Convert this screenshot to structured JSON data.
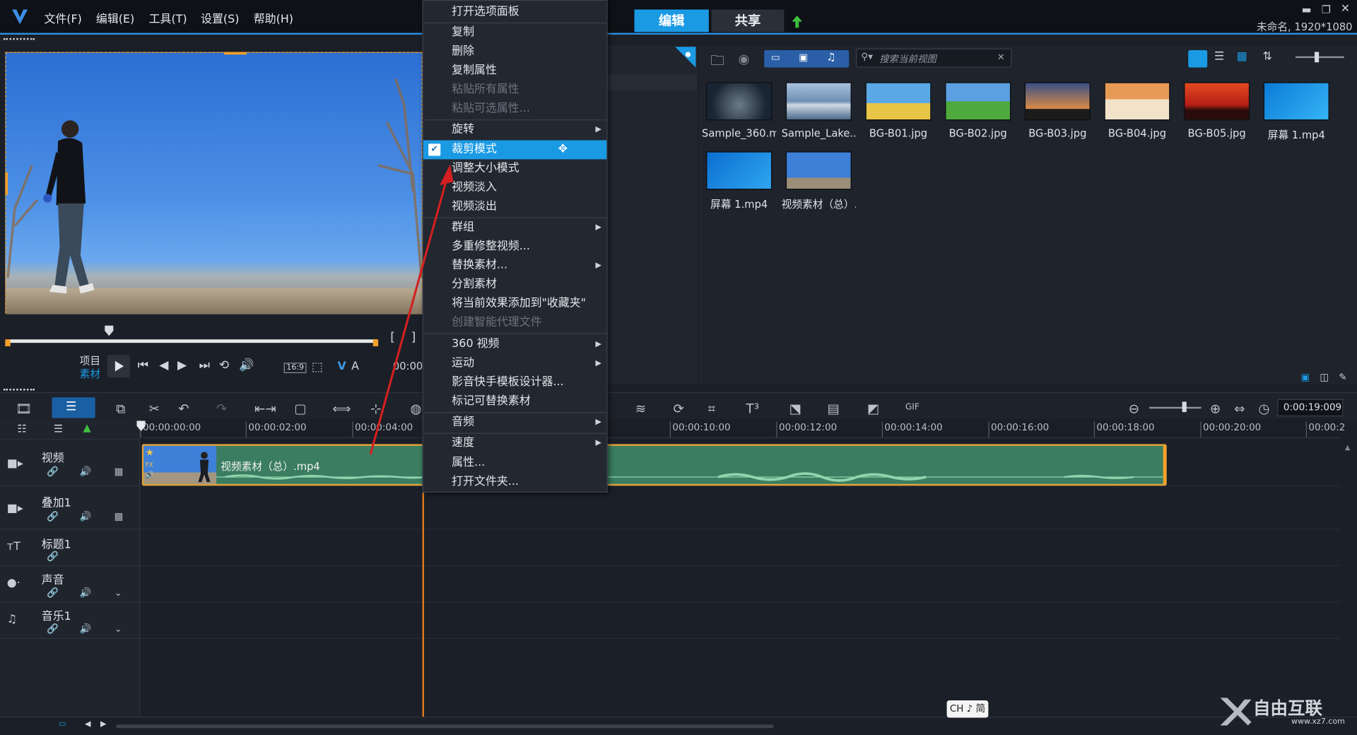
{
  "titlebar": {
    "menus": [
      "文件(F)",
      "编辑(E)",
      "工具(T)",
      "设置(S)",
      "帮助(H)"
    ],
    "tabs": [
      "编辑",
      "共享"
    ],
    "project_info": "未命名, 1920*1080"
  },
  "preview": {
    "mode_project": "项目",
    "mode_clip": "素材",
    "aspect": "16:9",
    "label_v": "V",
    "label_a": "A",
    "timecode": "00:00"
  },
  "library": {
    "search_placeholder": "搜索当前视图",
    "thumbnails": [
      {
        "caption": "Sample_360.m..."
      },
      {
        "caption": "Sample_Lake...."
      },
      {
        "caption": "BG-B01.jpg"
      },
      {
        "caption": "BG-B02.jpg"
      },
      {
        "caption": "BG-B03.jpg"
      },
      {
        "caption": "BG-B04.jpg"
      },
      {
        "caption": "BG-B05.jpg"
      },
      {
        "caption": "屏幕 1.mp4"
      },
      {
        "caption": "屏幕 1.mp4"
      },
      {
        "caption": "视频素材（总）...."
      }
    ]
  },
  "timeline": {
    "zoom_timecode": "0:00:19:009",
    "ruler_ticks": [
      "00:00:00:00",
      "00:00:02:00",
      "00:00:04:00",
      "00:00:10:00",
      "00:00:12:00",
      "00:00:14:00",
      "00:00:16:00",
      "00:00:18:00",
      "00:00:20:00",
      "00:00:2"
    ],
    "tracks": [
      {
        "name": "视频"
      },
      {
        "name": "叠加1"
      },
      {
        "name": "标题1"
      },
      {
        "name": "声音"
      },
      {
        "name": "音乐1"
      }
    ],
    "clip_name": "视频素材（总）.mp4",
    "clip_badge_fx": "FX"
  },
  "context_menu": {
    "items": [
      {
        "label": "打开选项面板",
        "disabled": false,
        "submenu": false
      },
      {
        "label": "复制",
        "disabled": false,
        "submenu": false
      },
      {
        "label": "删除",
        "disabled": false,
        "submenu": false
      },
      {
        "label": "复制属性",
        "disabled": false,
        "submenu": false
      },
      {
        "label": "粘贴所有属性",
        "disabled": true,
        "submenu": false
      },
      {
        "label": "粘贴可选属性...",
        "disabled": true,
        "submenu": false
      },
      {
        "label": "旋转",
        "disabled": false,
        "submenu": true
      },
      {
        "label": "裁剪模式",
        "disabled": false,
        "submenu": false,
        "checked": true,
        "highlighted": true
      },
      {
        "label": "调整大小模式",
        "disabled": false,
        "submenu": false
      },
      {
        "label": "视频淡入",
        "disabled": false,
        "submenu": false
      },
      {
        "label": "视频淡出",
        "disabled": false,
        "submenu": false
      },
      {
        "label": "群组",
        "disabled": false,
        "submenu": true
      },
      {
        "label": "多重修整视频...",
        "disabled": false,
        "submenu": false
      },
      {
        "label": "替换素材...",
        "disabled": false,
        "submenu": true
      },
      {
        "label": "分割素材",
        "disabled": false,
        "submenu": false
      },
      {
        "label": "将当前效果添加到\"收藏夹\"",
        "disabled": false,
        "submenu": false
      },
      {
        "label": "创建智能代理文件",
        "disabled": true,
        "submenu": false
      },
      {
        "label": "360 视频",
        "disabled": false,
        "submenu": true
      },
      {
        "label": "运动",
        "disabled": false,
        "submenu": true
      },
      {
        "label": "影音快手模板设计器...",
        "disabled": false,
        "submenu": false
      },
      {
        "label": "标记可替换素材",
        "disabled": false,
        "submenu": false
      },
      {
        "label": "音频",
        "disabled": false,
        "submenu": true
      },
      {
        "label": "速度",
        "disabled": false,
        "submenu": true
      },
      {
        "label": "属性...",
        "disabled": false,
        "submenu": false
      },
      {
        "label": "打开文件夹...",
        "disabled": false,
        "submenu": false
      }
    ]
  },
  "ime": {
    "label": "CH ♪ 简"
  },
  "watermark": {
    "text": "自由互联",
    "url": "www.xz7.com"
  },
  "colors": {
    "accent": "#1b9ae4",
    "clip": "#3b7d60",
    "clip_border": "#e3a43a",
    "playhead": "#e07a1e",
    "annotation_arrow": "#d42020"
  }
}
